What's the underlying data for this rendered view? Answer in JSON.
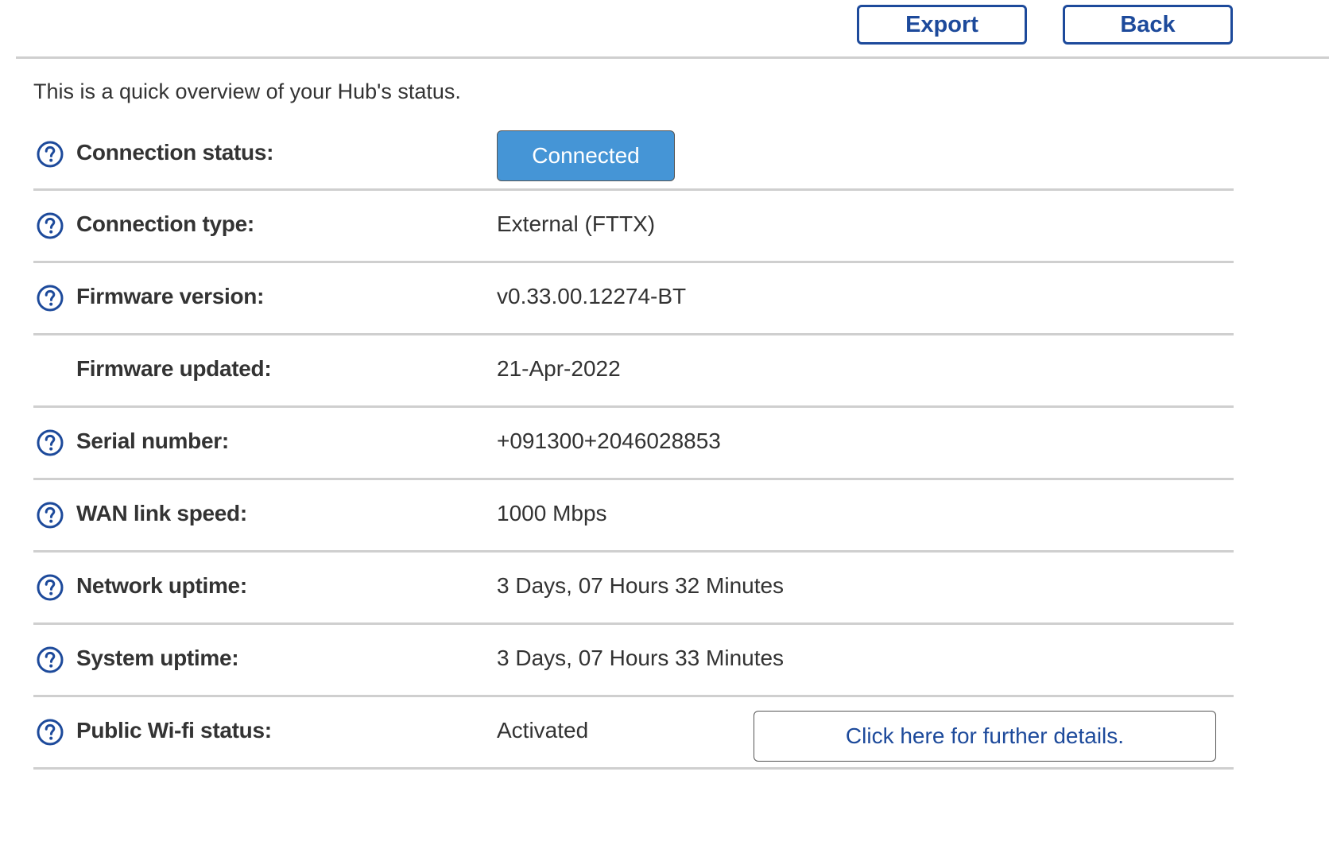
{
  "toolbar": {
    "export_label": "Export",
    "back_label": "Back"
  },
  "intro": "This is a quick overview of your Hub's status.",
  "colors": {
    "accent_blue": "#1d4a9b",
    "connected_badge": "#4595d6",
    "divider": "#cfcfcf",
    "text": "#333333"
  },
  "rows": [
    {
      "label": "Connection status:",
      "value": "Connected",
      "help_icon": "question-circle-icon"
    },
    {
      "label": "Connection type:",
      "value": "External (FTTX)",
      "help_icon": "question-circle-icon"
    },
    {
      "label": "Firmware version:",
      "value": "v0.33.00.12274-BT",
      "help_icon": "question-circle-icon"
    },
    {
      "label": "Firmware updated:",
      "value": "21-Apr-2022"
    },
    {
      "label": "Serial number:",
      "value": "+091300+2046028853",
      "help_icon": "question-circle-icon"
    },
    {
      "label": "WAN link speed:",
      "value": "1000 Mbps",
      "help_icon": "question-circle-icon"
    },
    {
      "label": "Network uptime:",
      "value": "3 Days, 07 Hours 32 Minutes",
      "help_icon": "question-circle-icon"
    },
    {
      "label": "System uptime:",
      "value": "3 Days, 07 Hours 33 Minutes",
      "help_icon": "question-circle-icon"
    },
    {
      "label": "Public Wi-fi status:",
      "value": "Activated",
      "help_icon": "question-circle-icon",
      "action_label": "Click here for further details."
    }
  ]
}
